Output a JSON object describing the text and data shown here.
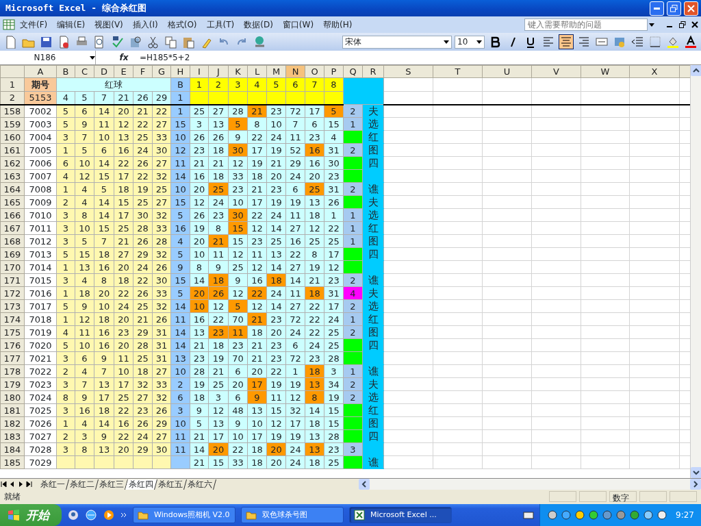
{
  "window": {
    "title": "Microsoft Excel - 综合杀红图"
  },
  "menu": [
    "文件(F)",
    "编辑(E)",
    "视图(V)",
    "插入(I)",
    "格式(O)",
    "工具(T)",
    "数据(D)",
    "窗口(W)",
    "帮助(H)"
  ],
  "help_box": {
    "placeholder": "键入需要帮助的问题"
  },
  "font_box": {
    "value": "宋体"
  },
  "size_box": {
    "value": "10"
  },
  "align_buttons": [
    {
      "selected": false
    },
    {
      "selected": true
    },
    {
      "selected": false
    }
  ],
  "formula_bar": {
    "name_box": "N186",
    "fx_label": "fx",
    "formula": "=H185*5+2"
  },
  "columns": [
    {
      "label": "A",
      "selected": false
    },
    {
      "label": "B",
      "selected": false
    },
    {
      "label": "C",
      "selected": false
    },
    {
      "label": "D",
      "selected": false
    },
    {
      "label": "E",
      "selected": false
    },
    {
      "label": "F",
      "selected": false
    },
    {
      "label": "G",
      "selected": false
    },
    {
      "label": "H",
      "selected": false
    },
    {
      "label": "I",
      "selected": false
    },
    {
      "label": "J",
      "selected": false
    },
    {
      "label": "K",
      "selected": false
    },
    {
      "label": "L",
      "selected": false
    },
    {
      "label": "M",
      "selected": false
    },
    {
      "label": "N",
      "selected": true
    },
    {
      "label": "O",
      "selected": false
    },
    {
      "label": "P",
      "selected": false
    },
    {
      "label": "Q",
      "selected": false
    },
    {
      "label": "R",
      "selected": false
    },
    {
      "label": "S",
      "selected": false
    },
    {
      "label": "T",
      "selected": false
    },
    {
      "label": "U",
      "selected": false
    },
    {
      "label": "V",
      "selected": false
    },
    {
      "label": "W",
      "selected": false
    },
    {
      "label": "X",
      "selected": false
    }
  ],
  "header": {
    "row_labels": [
      "1",
      "2"
    ],
    "issue_label": "期号",
    "issue": "5153",
    "red_label": "红球",
    "red": [
      "4",
      "5",
      "7",
      "21",
      "26",
      "29"
    ],
    "blue_label": "B",
    "blue": "1",
    "positions": [
      "1",
      "2",
      "3",
      "4",
      "5",
      "6",
      "7",
      "8"
    ]
  },
  "rows": [
    {
      "n": "158",
      "a": "7002",
      "red": [
        "5",
        "6",
        "14",
        "20",
        "21",
        "22"
      ],
      "b": "1",
      "nums": [
        "25",
        "27",
        "28",
        "21",
        "23",
        "72",
        "17",
        "5"
      ],
      "hot": [
        false,
        false,
        false,
        true,
        false,
        false,
        false,
        true
      ],
      "q": "2",
      "color": "#a6caf0",
      "r": "夫"
    },
    {
      "n": "159",
      "a": "7003",
      "red": [
        "5",
        "9",
        "11",
        "12",
        "22",
        "27"
      ],
      "b": "15",
      "nums": [
        "3",
        "13",
        "5",
        "8",
        "10",
        "7",
        "6",
        "15"
      ],
      "hot": [
        false,
        false,
        true,
        false,
        false,
        false,
        false,
        false
      ],
      "q": "1",
      "color": "#a6caf0",
      "r": "选"
    },
    {
      "n": "160",
      "a": "7004",
      "red": [
        "3",
        "7",
        "10",
        "13",
        "25",
        "33"
      ],
      "b": "10",
      "nums": [
        "26",
        "26",
        "9",
        "22",
        "24",
        "11",
        "23",
        "4"
      ],
      "hot": [
        false,
        false,
        false,
        false,
        false,
        false,
        false,
        false
      ],
      "color": "#00ff00",
      "r": "红"
    },
    {
      "n": "161",
      "a": "7005",
      "red": [
        "1",
        "5",
        "6",
        "16",
        "24",
        "30"
      ],
      "b": "12",
      "nums": [
        "23",
        "18",
        "30",
        "17",
        "19",
        "52",
        "16",
        "31"
      ],
      "hot": [
        false,
        false,
        true,
        false,
        false,
        false,
        true,
        false
      ],
      "q": "2",
      "color": "#a6caf0",
      "r": "图"
    },
    {
      "n": "162",
      "a": "7006",
      "red": [
        "6",
        "10",
        "14",
        "22",
        "26",
        "27"
      ],
      "b": "11",
      "nums": [
        "21",
        "21",
        "12",
        "19",
        "21",
        "29",
        "16",
        "30"
      ],
      "hot": [
        false,
        false,
        false,
        false,
        false,
        false,
        false,
        false
      ],
      "color": "#00ff00",
      "r": "四"
    },
    {
      "n": "163",
      "a": "7007",
      "red": [
        "4",
        "12",
        "15",
        "17",
        "22",
        "32"
      ],
      "b": "14",
      "nums": [
        "16",
        "18",
        "33",
        "18",
        "20",
        "24",
        "20",
        "23"
      ],
      "hot": [
        false,
        false,
        false,
        false,
        false,
        false,
        false,
        false
      ],
      "color": "#00ff00"
    },
    {
      "n": "164",
      "a": "7008",
      "red": [
        "1",
        "4",
        "5",
        "18",
        "19",
        "25"
      ],
      "b": "10",
      "nums": [
        "20",
        "25",
        "23",
        "21",
        "23",
        "6",
        "25",
        "31"
      ],
      "hot": [
        false,
        true,
        false,
        false,
        false,
        false,
        true,
        false
      ],
      "q": "2",
      "color": "#a6caf0",
      "r": "谯"
    },
    {
      "n": "165",
      "a": "7009",
      "red": [
        "2",
        "4",
        "14",
        "15",
        "25",
        "27"
      ],
      "b": "15",
      "nums": [
        "12",
        "24",
        "10",
        "17",
        "19",
        "19",
        "13",
        "26"
      ],
      "hot": [
        false,
        false,
        false,
        false,
        false,
        false,
        false,
        false
      ],
      "color": "#00ff00",
      "r": "夫"
    },
    {
      "n": "166",
      "a": "7010",
      "red": [
        "3",
        "8",
        "14",
        "17",
        "30",
        "32"
      ],
      "b": "5",
      "nums": [
        "26",
        "23",
        "30",
        "22",
        "24",
        "11",
        "18",
        "1"
      ],
      "hot": [
        false,
        false,
        true,
        false,
        false,
        false,
        false,
        false
      ],
      "q": "1",
      "color": "#a6caf0",
      "r": "选"
    },
    {
      "n": "167",
      "a": "7011",
      "red": [
        "3",
        "10",
        "15",
        "25",
        "28",
        "33"
      ],
      "b": "16",
      "nums": [
        "19",
        "8",
        "15",
        "12",
        "14",
        "27",
        "12",
        "22"
      ],
      "hot": [
        false,
        false,
        true,
        false,
        false,
        false,
        false,
        false
      ],
      "q": "1",
      "color": "#a6caf0",
      "r": "红"
    },
    {
      "n": "168",
      "a": "7012",
      "red": [
        "3",
        "5",
        "7",
        "21",
        "26",
        "28"
      ],
      "b": "4",
      "nums": [
        "20",
        "21",
        "15",
        "23",
        "25",
        "16",
        "25",
        "25"
      ],
      "hot": [
        false,
        true,
        false,
        false,
        false,
        false,
        false,
        false
      ],
      "q": "1",
      "color": "#a6caf0",
      "r": "图"
    },
    {
      "n": "169",
      "a": "7013",
      "red": [
        "5",
        "15",
        "18",
        "27",
        "29",
        "32"
      ],
      "b": "5",
      "nums": [
        "10",
        "11",
        "12",
        "11",
        "13",
        "22",
        "8",
        "17"
      ],
      "hot": [
        false,
        false,
        false,
        false,
        false,
        false,
        false,
        false
      ],
      "color": "#00ff00",
      "r": "四"
    },
    {
      "n": "170",
      "a": "7014",
      "red": [
        "1",
        "13",
        "16",
        "20",
        "24",
        "26"
      ],
      "b": "9",
      "nums": [
        "8",
        "9",
        "25",
        "12",
        "14",
        "27",
        "19",
        "12"
      ],
      "hot": [
        false,
        false,
        false,
        false,
        false,
        false,
        false,
        false
      ],
      "color": "#00ff00"
    },
    {
      "n": "171",
      "a": "7015",
      "red": [
        "3",
        "4",
        "8",
        "18",
        "22",
        "30"
      ],
      "b": "15",
      "nums": [
        "14",
        "18",
        "9",
        "16",
        "18",
        "14",
        "21",
        "23"
      ],
      "hot": [
        false,
        true,
        false,
        false,
        true,
        false,
        false,
        false
      ],
      "q": "2",
      "color": "#a6caf0",
      "r": "谯"
    },
    {
      "n": "172",
      "a": "7016",
      "red": [
        "1",
        "18",
        "20",
        "22",
        "26",
        "33"
      ],
      "b": "5",
      "nums": [
        "20",
        "26",
        "12",
        "22",
        "24",
        "11",
        "18",
        "31"
      ],
      "hot": [
        true,
        true,
        false,
        true,
        false,
        false,
        true,
        false
      ],
      "q": "4",
      "color": "#ff00ff",
      "r": "夫"
    },
    {
      "n": "173",
      "a": "7017",
      "red": [
        "5",
        "9",
        "10",
        "24",
        "25",
        "32"
      ],
      "b": "14",
      "nums": [
        "10",
        "12",
        "5",
        "12",
        "14",
        "27",
        "22",
        "17"
      ],
      "hot": [
        true,
        false,
        true,
        false,
        false,
        false,
        false,
        false
      ],
      "q": "2",
      "color": "#a6caf0",
      "r": "选"
    },
    {
      "n": "174",
      "a": "7018",
      "red": [
        "1",
        "12",
        "18",
        "20",
        "21",
        "26"
      ],
      "b": "11",
      "nums": [
        "16",
        "22",
        "70",
        "21",
        "23",
        "72",
        "22",
        "24"
      ],
      "hot": [
        false,
        false,
        false,
        true,
        false,
        false,
        false,
        false
      ],
      "q": "1",
      "color": "#a6caf0",
      "r": "红"
    },
    {
      "n": "175",
      "a": "7019",
      "red": [
        "4",
        "11",
        "16",
        "23",
        "29",
        "31"
      ],
      "b": "14",
      "nums": [
        "13",
        "23",
        "11",
        "18",
        "20",
        "24",
        "22",
        "25"
      ],
      "hot": [
        false,
        true,
        true,
        false,
        false,
        false,
        false,
        false
      ],
      "q": "2",
      "color": "#a6caf0",
      "r": "图"
    },
    {
      "n": "176",
      "a": "7020",
      "red": [
        "5",
        "10",
        "16",
        "20",
        "28",
        "31"
      ],
      "b": "14",
      "nums": [
        "21",
        "18",
        "23",
        "21",
        "23",
        "6",
        "24",
        "25"
      ],
      "hot": [
        false,
        false,
        false,
        false,
        false,
        false,
        false,
        false
      ],
      "color": "#00ff00",
      "r": "四"
    },
    {
      "n": "177",
      "a": "7021",
      "red": [
        "3",
        "6",
        "9",
        "11",
        "25",
        "31"
      ],
      "b": "13",
      "nums": [
        "23",
        "19",
        "70",
        "21",
        "23",
        "72",
        "23",
        "28"
      ],
      "hot": [
        false,
        false,
        false,
        false,
        false,
        false,
        false,
        false
      ],
      "color": "#00ff00"
    },
    {
      "n": "178",
      "a": "7022",
      "red": [
        "2",
        "4",
        "7",
        "10",
        "18",
        "27"
      ],
      "b": "10",
      "nums": [
        "28",
        "21",
        "6",
        "20",
        "22",
        "1",
        "18",
        "3"
      ],
      "hot": [
        false,
        false,
        false,
        false,
        false,
        false,
        true,
        false
      ],
      "q": "1",
      "color": "#a6caf0",
      "r": "谯"
    },
    {
      "n": "179",
      "a": "7023",
      "red": [
        "3",
        "7",
        "13",
        "17",
        "32",
        "33"
      ],
      "b": "2",
      "nums": [
        "19",
        "25",
        "20",
        "17",
        "19",
        "19",
        "13",
        "34"
      ],
      "hot": [
        false,
        false,
        false,
        true,
        false,
        false,
        true,
        false
      ],
      "q": "2",
      "color": "#a6caf0",
      "r": "夫"
    },
    {
      "n": "180",
      "a": "7024",
      "red": [
        "8",
        "9",
        "17",
        "25",
        "27",
        "32"
      ],
      "b": "6",
      "nums": [
        "18",
        "3",
        "6",
        "9",
        "11",
        "12",
        "8",
        "19"
      ],
      "hot": [
        false,
        false,
        false,
        true,
        false,
        false,
        true,
        false
      ],
      "q": "2",
      "color": "#a6caf0",
      "r": "选"
    },
    {
      "n": "181",
      "a": "7025",
      "red": [
        "3",
        "16",
        "18",
        "22",
        "23",
        "26"
      ],
      "b": "3",
      "nums": [
        "9",
        "12",
        "48",
        "13",
        "15",
        "32",
        "14",
        "15"
      ],
      "hot": [
        false,
        false,
        false,
        false,
        false,
        false,
        false,
        false
      ],
      "color": "#00ff00",
      "r": "红"
    },
    {
      "n": "182",
      "a": "7026",
      "red": [
        "1",
        "4",
        "14",
        "16",
        "26",
        "29"
      ],
      "b": "10",
      "nums": [
        "5",
        "13",
        "9",
        "10",
        "12",
        "17",
        "18",
        "15"
      ],
      "hot": [
        false,
        false,
        false,
        false,
        false,
        false,
        false,
        false
      ],
      "color": "#00ff00",
      "r": "图"
    },
    {
      "n": "183",
      "a": "7027",
      "red": [
        "2",
        "3",
        "9",
        "22",
        "24",
        "27"
      ],
      "b": "11",
      "nums": [
        "21",
        "17",
        "10",
        "17",
        "19",
        "19",
        "13",
        "28"
      ],
      "hot": [
        false,
        false,
        false,
        false,
        false,
        false,
        false,
        false
      ],
      "color": "#00ff00",
      "r": "四"
    },
    {
      "n": "184",
      "a": "7028",
      "red": [
        "3",
        "8",
        "13",
        "20",
        "29",
        "30"
      ],
      "b": "11",
      "nums": [
        "14",
        "20",
        "22",
        "18",
        "20",
        "24",
        "13",
        "23"
      ],
      "hot": [
        false,
        true,
        false,
        false,
        true,
        false,
        true,
        false
      ],
      "q": "3",
      "color": "#a6caf0"
    },
    {
      "n": "185",
      "a": "7029",
      "nums": [
        "21",
        "15",
        "33",
        "18",
        "20",
        "24",
        "18",
        "25"
      ],
      "hot": [
        false,
        false,
        false,
        false,
        false,
        false,
        false,
        false
      ],
      "color": "#00ff00",
      "r": "谯"
    }
  ],
  "sheet_tabs": [
    {
      "label": "杀红一",
      "selected": false
    },
    {
      "label": "杀红二",
      "selected": false
    },
    {
      "label": "杀红三",
      "selected": false
    },
    {
      "label": "杀红四",
      "selected": true
    },
    {
      "label": "杀红五",
      "selected": false
    },
    {
      "label": "杀红六",
      "selected": false
    }
  ],
  "status_bar": {
    "left": "就绪",
    "mode": "数字"
  },
  "taskbar": {
    "start": "开始",
    "tasks": [
      {
        "label": "Windows照相机 V2.0",
        "kind": "folder",
        "selected": false
      },
      {
        "label": "双色球杀号图",
        "kind": "folder",
        "selected": false
      },
      {
        "label": "Microsoft Excel ...",
        "kind": "excel",
        "selected": true
      }
    ],
    "clock": "9:27"
  }
}
